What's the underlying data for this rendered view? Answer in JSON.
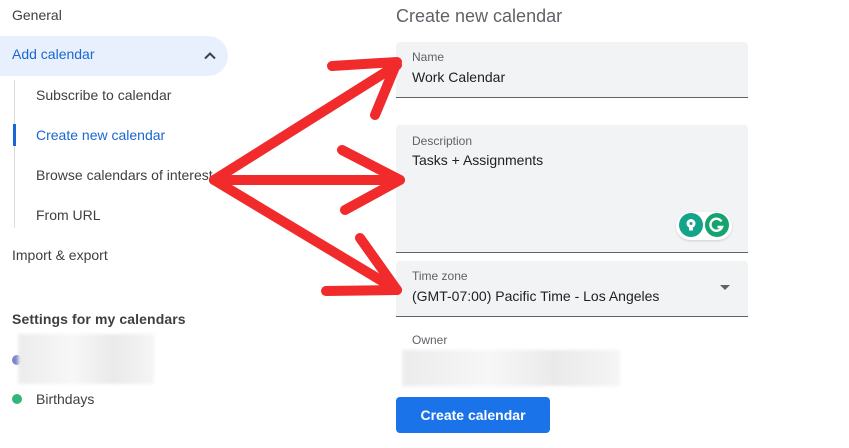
{
  "sidebar": {
    "general": "General",
    "add_calendar": "Add calendar",
    "sub_items": [
      "Subscribe to calendar",
      "Create new calendar",
      "Browse calendars of interest",
      "From URL"
    ],
    "import_export": "Import & export",
    "settings_title": "Settings for my calendars",
    "calendars": [
      {
        "label": "",
        "color": "#7986cb"
      },
      {
        "label": "Birthdays",
        "color": "#33b679"
      }
    ]
  },
  "form": {
    "title": "Create new calendar",
    "name": {
      "label": "Name",
      "value": "Work Calendar"
    },
    "description": {
      "label": "Description",
      "value": "Tasks + Assignments"
    },
    "timezone": {
      "label": "Time zone",
      "value": "(GMT-07:00) Pacific Time - Los Angeles"
    },
    "owner": {
      "label": "Owner"
    },
    "create_button": "Create calendar"
  },
  "colors": {
    "accent": "#1a73e8",
    "active_nav_bg": "#e8f0fe",
    "annotation_arrow": "#f12b2b"
  },
  "icons": {
    "chevron": "chevron-up-icon",
    "dropdown": "arrow-drop-down-icon",
    "extension_1": "lightbulb-icon",
    "extension_2": "grammarly-icon"
  }
}
